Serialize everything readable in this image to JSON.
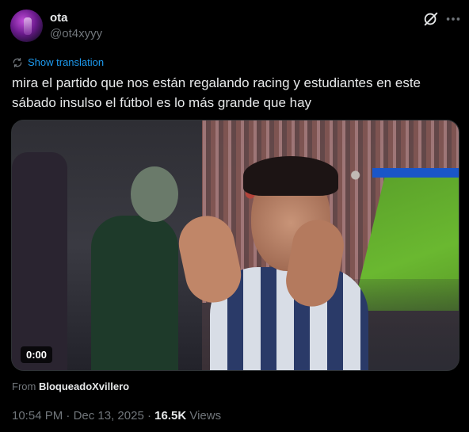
{
  "author": {
    "name": "ota",
    "handle": "@ot4xyyy"
  },
  "icons": {
    "grok": "grok-icon",
    "more": "more-icon",
    "translate": "translate-icon"
  },
  "translation_label": "Show translation",
  "tweet_text": "mira el partido que nos están regalando racing y estudiantes en este sábado insulso el fútbol es lo más grande que hay",
  "video": {
    "duration": "0:00"
  },
  "source": {
    "prefix": "From",
    "user": "BloqueadoXvillero"
  },
  "meta": {
    "time": "10:54 PM",
    "separator": " · ",
    "date": "Dec 13, 2025",
    "views_count": "16.5K",
    "views_label": " Views"
  },
  "colors": {
    "background": "#000000",
    "text": "#e7e9ea",
    "secondary": "#71767b",
    "accent": "#1d9bf0"
  }
}
